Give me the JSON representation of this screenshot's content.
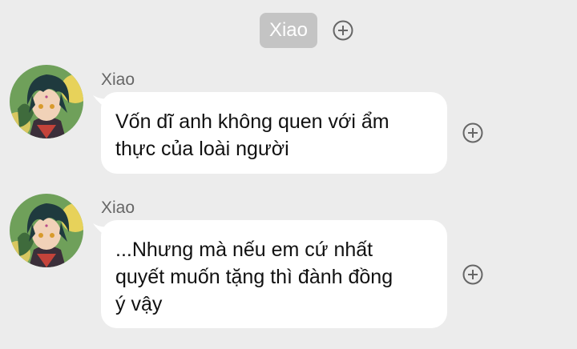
{
  "header": {
    "name_chip": "Xiao"
  },
  "messages": [
    {
      "sender": "Xiao",
      "lines": [
        "Vốn dĩ anh không quen với ẩm",
        "thực của loài người"
      ]
    },
    {
      "sender": "Xiao",
      "lines": [
        "...Nhưng mà nếu em cứ nhất",
        "quyết muốn tặng thì đành đồng",
        "ý vậy"
      ]
    }
  ],
  "icons": {
    "add": "plus-circle-icon"
  },
  "colors": {
    "background": "#ececec",
    "chip": "#c4c4c4",
    "bubble": "#ffffff",
    "icon": "#666666"
  }
}
